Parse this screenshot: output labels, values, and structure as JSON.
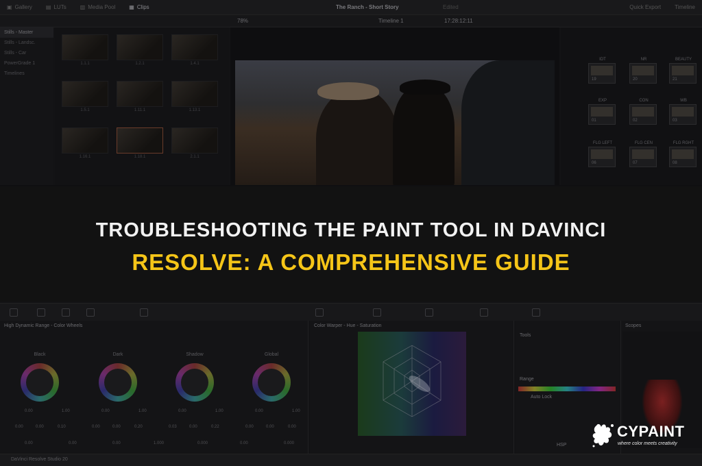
{
  "topbar": {
    "tabs": [
      "Gallery",
      "LUTs",
      "Media Pool",
      "Clips"
    ],
    "project_title": "The Ranch - Short Story",
    "status": "Edited",
    "right_items": [
      "Quick Export",
      "Timeline"
    ]
  },
  "subbar": {
    "zoom": "78%",
    "timeline_name": "Timeline 1",
    "timecode": "17:28:12:11"
  },
  "gallery": {
    "albums": [
      "Stills - Master",
      "Stills - Landsc.",
      "Stills - Car",
      "PowerGrade 1",
      "Timelines"
    ],
    "thumb_labels": [
      "1.1.1",
      "1.2.1",
      "1.4.1",
      "1.5.1",
      "1.11.1",
      "1.13.1",
      "1.16.1",
      "1.18.1",
      "2.1.1"
    ]
  },
  "nodes": {
    "items": [
      {
        "label": "IDT",
        "num": "19"
      },
      {
        "label": "NR",
        "num": "20"
      },
      {
        "label": "BEAUTY",
        "num": "21"
      },
      {
        "label": "EXP",
        "num": "01"
      },
      {
        "label": "CON",
        "num": "02"
      },
      {
        "label": "WB",
        "num": "03"
      },
      {
        "label": "FLG LEFT",
        "num": "06"
      },
      {
        "label": "FLG CEN",
        "num": "07"
      },
      {
        "label": "FLG RGHT",
        "num": "08"
      }
    ]
  },
  "headline": {
    "line1": "TROUBLESHOOTING THE PAINT TOOL IN DAVINCI",
    "line2": "RESOLVE: A COMPREHENSIVE GUIDE"
  },
  "wheels_panel": {
    "title": "High Dynamic Range - Color Wheels",
    "wheels": [
      {
        "name": "Black",
        "lum": "0.00",
        "sat": "1.00",
        "x": "0.00",
        "y": "0.00",
        "z": "0.10"
      },
      {
        "name": "Dark",
        "lum": "0.00",
        "sat": "1.00",
        "x": "0.00",
        "y": "0.00",
        "z": "0.20"
      },
      {
        "name": "Shadow",
        "lum": "0.00",
        "sat": "1.00",
        "x": "0.03",
        "y": "0.00",
        "z": "0.22"
      },
      {
        "name": "Global",
        "lum": "0.00",
        "sat": "1.00",
        "x": "0.00",
        "y": "0.00",
        "z": "0.00"
      }
    ],
    "footer": {
      "temp": "0.00",
      "tint": "0.00",
      "hue": "0.00",
      "contrast": "1.000",
      "pivot": "0.000",
      "md": "0.00",
      "bofs": "0.000"
    }
  },
  "warper_panel": {
    "title": "Color Warper - Hue - Saturation"
  },
  "tools_panel": {
    "tools_label": "Tools",
    "range_label": "Range",
    "auto_lock": "Auto Lock",
    "mode": "HSP"
  },
  "scopes_panel": {
    "title": "Scopes"
  },
  "bottombar": {
    "app_name": "DaVinci Resolve Studio 20"
  },
  "logo": {
    "brand": "CYPAINT",
    "tagline": "where color meets creativity"
  }
}
